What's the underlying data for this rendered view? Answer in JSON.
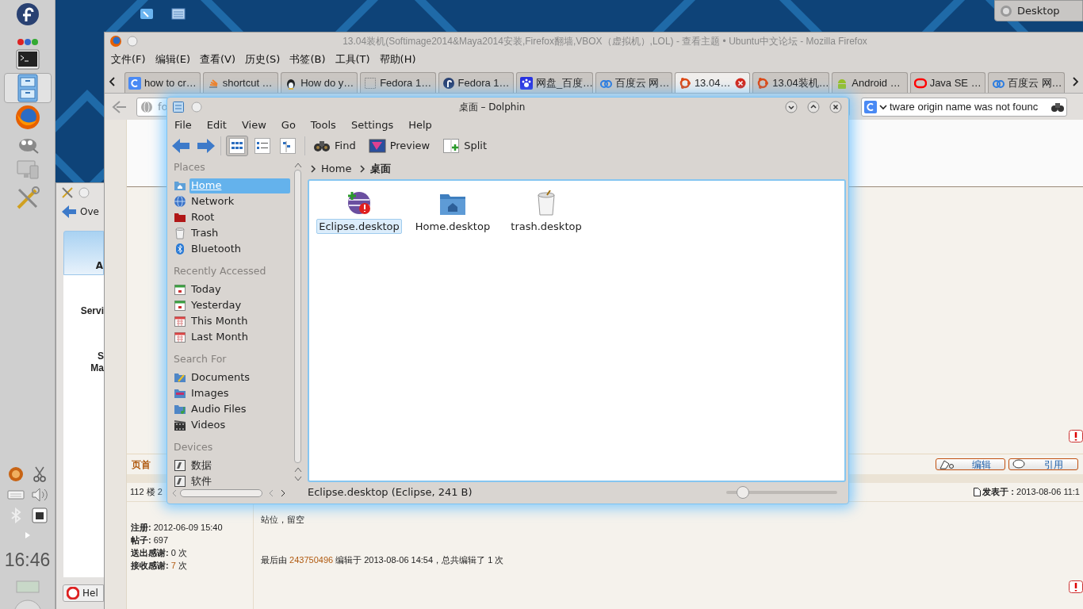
{
  "panel": {
    "launchers": [
      {
        "kind": "terminal",
        "selected": false
      },
      {
        "kind": "files",
        "selected": true
      },
      {
        "kind": "browser",
        "selected": false
      },
      {
        "kind": "gimp",
        "selected": false
      },
      {
        "kind": "monitor",
        "selected": false
      },
      {
        "kind": "tools",
        "selected": false
      }
    ],
    "clock": "16:46"
  },
  "desktop_button": {
    "label": "Desktop"
  },
  "settings_window": {
    "back_label": "Ove",
    "tile_label": "A",
    "labels": [
      {
        "lines": [
          "Servi"
        ]
      },
      {
        "lines": [
          "S",
          "Ma"
        ]
      }
    ],
    "help_label": "Hel"
  },
  "firefox": {
    "title": "13.04装机(Softimage2014&Maya2014安装,Firefox翻墙,VBOX（虚拟机）,LOL) - 查看主题 • Ubuntu中文论坛 - Mozilla Firefox",
    "menu": [
      "文件(F)",
      "编辑(E)",
      "查看(V)",
      "历史(S)",
      "书签(B)",
      "工具(T)",
      "帮助(H)"
    ],
    "tabs": [
      {
        "label": "how to cr…",
        "kind": "google",
        "selected": false
      },
      {
        "label": "shortcut …",
        "kind": "stack",
        "selected": false
      },
      {
        "label": "How do y…",
        "kind": "tux",
        "selected": false
      },
      {
        "label": "Fedora 1…",
        "kind": "blank",
        "selected": false
      },
      {
        "label": "Fedora 1…",
        "kind": "fedora",
        "selected": false
      },
      {
        "label": "网盘_百度…",
        "kind": "paw",
        "selected": false
      },
      {
        "label": "百度云 网…",
        "kind": "cloud",
        "selected": false
      },
      {
        "label": "13.04…",
        "kind": "ubuntu",
        "selected": true
      },
      {
        "label": "13.04装机…",
        "kind": "ubuntu",
        "selected": false
      },
      {
        "label": "Android …",
        "kind": "android",
        "selected": false
      },
      {
        "label": "Java SE …",
        "kind": "oracle",
        "selected": false
      },
      {
        "label": "百度云 网…",
        "kind": "cloud",
        "selected": false
      }
    ],
    "url": "fo",
    "search": "tware origin name was not founc"
  },
  "forum": {
    "top_link": "页首",
    "post_buttons": [
      {
        "kind": "edit",
        "label": "编辑"
      },
      {
        "kind": "quote",
        "label": "引用"
      }
    ],
    "floor": "112 楼 2",
    "posted": "**发表于 :** 2013-08-06 11:1",
    "user": [
      {
        "label": "注册:",
        "value": "2012-06-09 15:40",
        "highlight": false
      },
      {
        "label": "帖子:",
        "value": "697",
        "highlight": false
      },
      {
        "label": "送出感谢:",
        "value": "0",
        "unit": "次",
        "highlight": false
      },
      {
        "label": "接收感谢:",
        "value": "7",
        "unit": "次",
        "highlight": true
      }
    ],
    "body": "站位，留空",
    "edit_note": {
      "prefix": "最后由",
      "editor": "243750496",
      "suffix": "编辑于 2013-08-06 14:54，总共编辑了 1 次"
    }
  },
  "dolphin": {
    "title": "桌面 – Dolphin",
    "menu": [
      "File",
      "Edit",
      "View",
      "Go",
      "Tools",
      "Settings",
      "Help"
    ],
    "view_modes": [
      {
        "kind": "icons",
        "selected": true
      },
      {
        "kind": "details",
        "selected": false
      },
      {
        "kind": "columns",
        "selected": false
      }
    ],
    "actions": [
      {
        "kind": "find",
        "label": "Find"
      },
      {
        "kind": "preview",
        "label": "Preview"
      },
      {
        "kind": "split",
        "label": "Split"
      }
    ],
    "sections": [
      {
        "title": "Places",
        "items": [
          {
            "label": "Home",
            "kind": "home",
            "selected": true
          },
          {
            "label": "Network",
            "kind": "network",
            "selected": false
          },
          {
            "label": "Root",
            "kind": "root",
            "selected": false
          },
          {
            "label": "Trash",
            "kind": "trash",
            "selected": false
          },
          {
            "label": "Bluetooth",
            "kind": "bluetooth",
            "selected": false
          }
        ]
      },
      {
        "title": "Recently Accessed",
        "items": [
          {
            "label": "Today",
            "kind": "day",
            "selected": false
          },
          {
            "label": "Yesterday",
            "kind": "day",
            "selected": false
          },
          {
            "label": "This Month",
            "kind": "month",
            "selected": false
          },
          {
            "label": "Last Month",
            "kind": "month",
            "selected": false
          }
        ]
      },
      {
        "title": "Search For",
        "items": [
          {
            "label": "Documents",
            "kind": "documents",
            "selected": false
          },
          {
            "label": "Images",
            "kind": "images",
            "selected": false
          },
          {
            "label": "Audio Files",
            "kind": "audio",
            "selected": false
          },
          {
            "label": "Videos",
            "kind": "videos",
            "selected": false
          }
        ]
      },
      {
        "title": "Devices",
        "items": [
          {
            "label": "数据",
            "kind": "drive",
            "selected": false
          },
          {
            "label": "软件",
            "kind": "drive",
            "selected": false
          }
        ]
      }
    ],
    "breadcrumb": [
      "Home",
      "桌面"
    ],
    "files": [
      {
        "name": "Eclipse.desktop",
        "kind": "eclipse",
        "selected": true
      },
      {
        "name": "Home.desktop",
        "kind": "homefolder",
        "selected": false
      },
      {
        "name": "trash.desktop",
        "kind": "trash",
        "selected": false
      }
    ],
    "status": "Eclipse.desktop (Eclipse, 241 B)",
    "zoom": {
      "level": 0.15
    }
  }
}
